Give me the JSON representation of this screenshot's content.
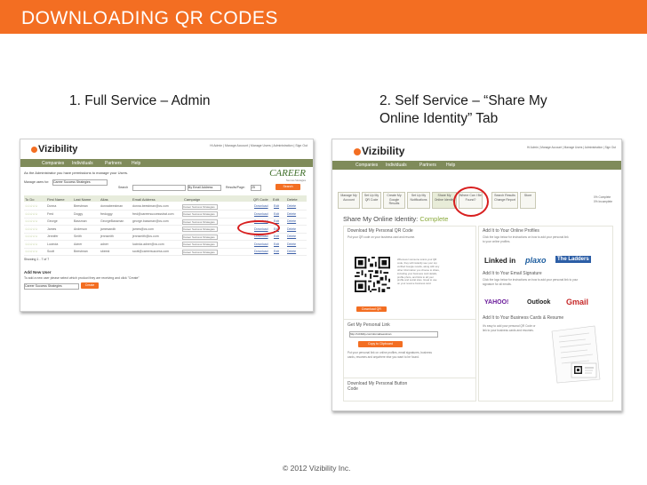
{
  "slide": {
    "title": "DOWNLOADING QR CODES",
    "section1": "1. Full Service – Admin",
    "section2_line1": "2. Self Service – “Share My",
    "section2_line2": "Online Identity” Tab",
    "footer": "© 2012 Vizibility Inc."
  },
  "shot1": {
    "logo": "Vizibility",
    "top_links": "Hi Admin | Manage Account | Manage Users | Administration | Sign Out",
    "nav": [
      "Companies",
      "Individuals",
      "Partners",
      "Help"
    ],
    "permission_text": "As the Administrator you have permissions to manage your Users.",
    "brand": "CAREER",
    "brand_sub": "Success Strategies",
    "manage_label": "Manage users for:",
    "manage_value": "Career Success Strategies",
    "search_label": "Search",
    "email_select": "By Email Address",
    "results_label": "Results/Page:",
    "results_value": "25",
    "search_button": "Search",
    "columns": [
      "To Do",
      "First Name",
      "Last Name",
      "Alias",
      "Email Address",
      "Campaign",
      "QR Code",
      "Edit",
      "Delete"
    ],
    "rows": [
      {
        "stars": "☆☆☆☆☆",
        "first": "Donna",
        "last": "Beestman",
        "alias": "donnabeestman",
        "email": "donna.beestman@cs.com",
        "campaign": "Career Success Strategies",
        "qr": "Download",
        "edit": "Edit",
        "delete": "Delete"
      },
      {
        "stars": "☆☆☆☆☆",
        "first": "Fred",
        "last": "Doggy",
        "alias": "fredoggy",
        "email": "fred@careersuccessstrat.com",
        "campaign": "Career Success Strategies",
        "qr": "Download",
        "edit": "Edit",
        "delete": "Delete"
      },
      {
        "stars": "☆☆☆☆☆",
        "first": "George",
        "last": "Bassman",
        "alias": "GeorgeBassman",
        "email": "george.bassman@cs.com",
        "campaign": "Career Success Strategies",
        "qr": "Download",
        "edit": "Edit",
        "delete": "Delete"
      },
      {
        "stars": "☆☆☆☆☆",
        "first": "James",
        "last": "Anderson",
        "alias": "jamesandb",
        "email": "james@cs.com",
        "campaign": "Career Success Strategies",
        "qr": "Download",
        "edit": "Edit",
        "delete": "Delete"
      },
      {
        "stars": "☆☆☆☆☆",
        "first": "Jennifer",
        "last": "Smith",
        "alias": "jennsmith",
        "email": "jennsmith@cs.com",
        "campaign": "Career Success Strategies",
        "qr": "Download",
        "edit": "Edit",
        "delete": "Delete"
      },
      {
        "stars": "☆☆☆☆☆",
        "first": "Lucinda",
        "last": "Adner",
        "alias": "adner",
        "email": "lucinda.adner@cs.com",
        "campaign": "Career Success Strategies",
        "qr": "Download",
        "edit": "Edit",
        "delete": "Delete"
      },
      {
        "stars": "☆☆☆☆☆",
        "first": "Scott",
        "last": "Beestman",
        "alias": "sbeest",
        "email": "scott@careersuccess.com",
        "campaign": "Career Success Strategies",
        "qr": "Download",
        "edit": "Edit",
        "delete": "Delete"
      }
    ],
    "showing": "Showing 1 - 7 of 7",
    "add_user": "Add New User",
    "add_desc": "To add a new user please select which product they are receiving and click \"Create\"",
    "add_select": "Career Success Strategies",
    "create_button": "Create"
  },
  "shot2": {
    "logo": "Vizibility",
    "top_links": "Hi Admin | Manage Account | Manage Users | Administration | Sign Out",
    "nav": [
      "Companies",
      "Individuals",
      "Partners",
      "Help"
    ],
    "tabs": [
      "Manage My Account",
      "Set Up My QR Code",
      "Create My Google Results",
      "Set Up My Notifications",
      "Share My Online Identity",
      "Where Can I Be Found?",
      "Search Results Change Report",
      "Store"
    ],
    "progress_line1": "0% Complete",
    "progress_line2": "0% Incomplete",
    "heading_prefix": "Share My Online Identity:",
    "heading_status": "Complete",
    "download_title": "Download My Personal QR Code",
    "download_text": "Put your QR code on your business card and resume.",
    "qr_desc": "Whenever someone scans your QR code, they will instantly see your top verified Google results, along with any other information you choose to share, including your business card details, profile photo, and links to all your profile and social sites. Great to use on your resume business card.",
    "download_button": "Download QR",
    "personal_link_title": "Get My Personal Link",
    "personal_link_value": "http://vizibility.com/donnabeestman",
    "copy_button": "Copy to Clipboard",
    "link_text": "Put your personal link on online profiles, email signatures, business cards, resumes and anywhere else you want to be found.",
    "button_code": "Download My Personal Button Code",
    "profiles_title": "Add It to Your Online Profiles",
    "profiles_text": "Click the logo below for instructions on how to add your personal link to your online profiles.",
    "social_linkedin": "Linked in",
    "social_plaxo": "plaxo",
    "social_ladders": "The Ladders",
    "email_title": "Add It to Your Email Signature",
    "email_text": "Click the logo below for instructions on how to add your personal link to your signature for all emails.",
    "social_yahoo": "YAHOO!",
    "social_outlook": "Outlook",
    "social_gmail": "Gmail",
    "business_title": "Add It to Your Business Cards & Resume",
    "business_text": "It's easy to add your personal QR Code or link to your business cards and resumes."
  }
}
